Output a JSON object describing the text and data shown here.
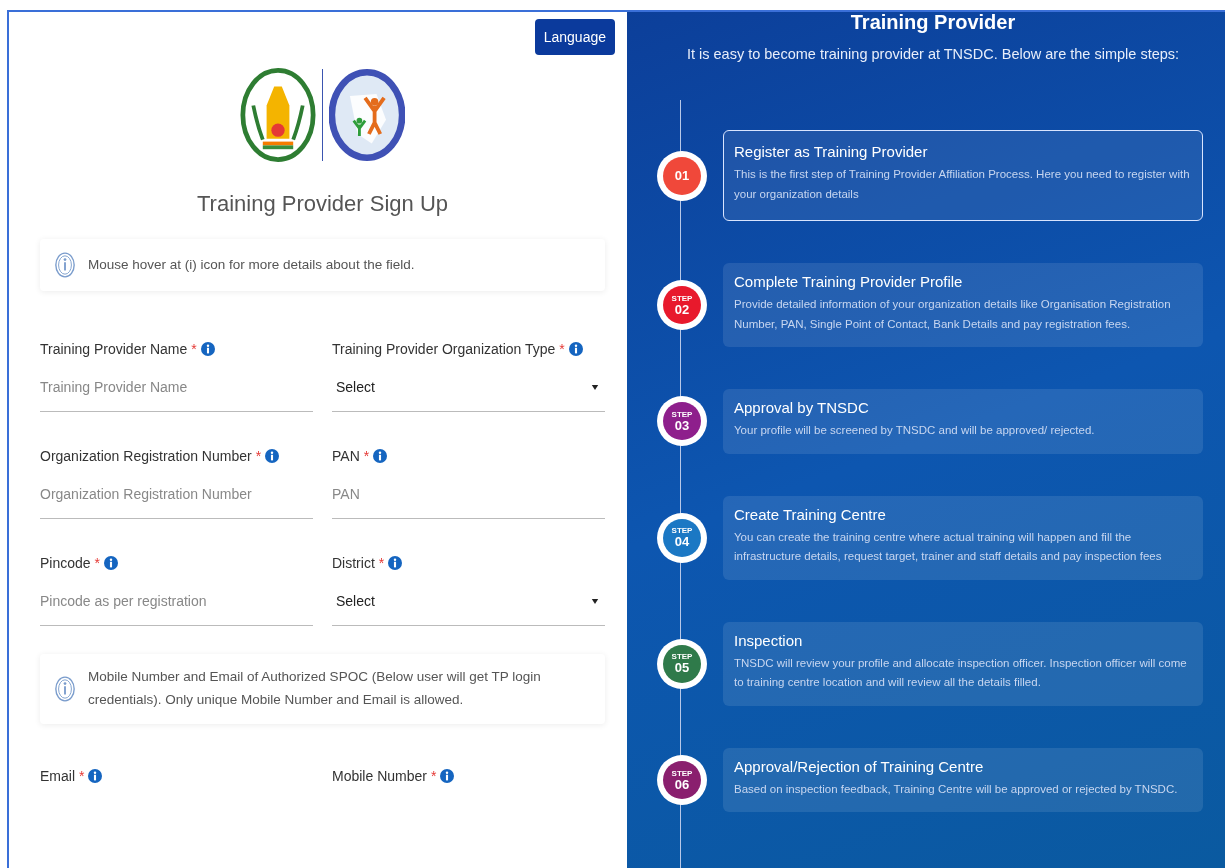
{
  "language_button": "Language",
  "form_title": "Training Provider Sign Up",
  "notes": [
    {
      "text": "Mouse hover at (i) icon for more details about the field."
    },
    {
      "text": "Mobile Number and Email of Authorized SPOC (Below user will get TP login credentials). Only unique Mobile Number and Email is allowed."
    }
  ],
  "fields": [
    {
      "label": "Training Provider Name",
      "required_mark": "*",
      "kind": "text",
      "placeholder": "Training Provider Name"
    },
    {
      "label": "Training Provider Organization Type",
      "required_mark": "*",
      "kind": "select",
      "value": "Select"
    },
    {
      "label": "Organization Registration Number",
      "required_mark": "*",
      "kind": "text",
      "placeholder": "Organization Registration Number"
    },
    {
      "label": "PAN",
      "required_mark": "*",
      "kind": "text",
      "placeholder": "PAN"
    },
    {
      "label": "Pincode",
      "required_mark": "*",
      "kind": "text",
      "placeholder": "Pincode as per registration"
    },
    {
      "label": "District",
      "required_mark": "*",
      "kind": "select",
      "value": "Select"
    }
  ],
  "contact_fields": [
    {
      "label": "Email",
      "required_mark": "*"
    },
    {
      "label": "Mobile Number",
      "required_mark": "*"
    }
  ],
  "side": {
    "title": "Training Provider",
    "subtitle": "It is easy to become training provider at TNSDC. Below are the simple steps:",
    "steps": [
      {
        "badge": "01",
        "title": "Register as Training Provider",
        "text": "This is the first step of Training Provider Affiliation Process. Here you need to register with your organization details",
        "color": "#f0483a",
        "selected": true
      },
      {
        "badge_label": "STEP",
        "badge": "02",
        "title": "Complete Training Provider Profile",
        "text": "Provide detailed information of your organization details like Organisation Registration Number, PAN, Single Point of Contact, Bank Details and pay registration fees.",
        "color": "#e8192c",
        "selected": false
      },
      {
        "badge_label": "STEP",
        "badge": "03",
        "title": "Approval by TNSDC",
        "text": "Your profile will be screened by TNSDC and will be approved/ rejected.",
        "color": "#8e1f8c",
        "selected": false
      },
      {
        "badge_label": "STEP",
        "badge": "04",
        "title": "Create Training Centre",
        "text": "You can create the training centre where actual training will happen and fill the infrastructure details, request target, trainer and staff details and pay inspection fees",
        "color": "#1b78c4",
        "selected": false
      },
      {
        "badge_label": "STEP",
        "badge": "05",
        "title": "Inspection",
        "text": "TNSDC will review your profile and allocate inspection officer. Inspection officer will come to training centre location and will review all the details filled.",
        "color": "#2f7a4a",
        "selected": false
      },
      {
        "badge_label": "STEP",
        "badge": "06",
        "title": "Approval/Rejection of Training Centre",
        "text": "Based on inspection feedback, Training Centre will be approved or rejected by TNSDC.",
        "color": "#8a1f6e",
        "selected": false
      }
    ]
  }
}
